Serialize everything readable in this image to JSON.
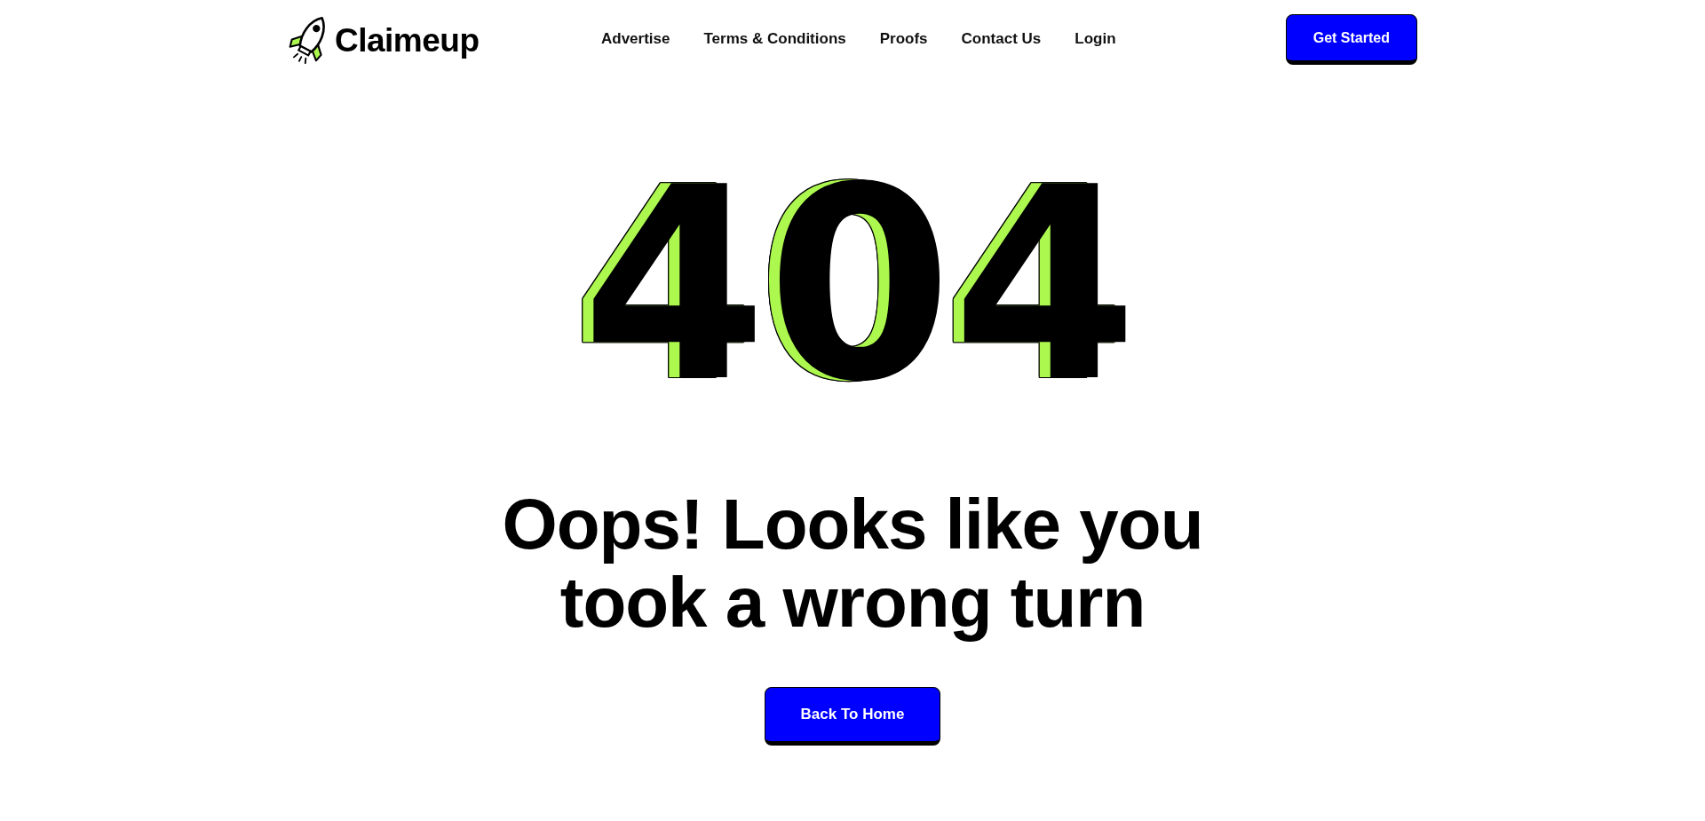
{
  "header": {
    "logo": "Claimeup",
    "nav": [
      "Advertise",
      "Terms & Conditions",
      "Proofs",
      "Contact Us",
      "Login"
    ],
    "cta": "Get Started"
  },
  "error": {
    "code": "404",
    "message": "Oops! Looks like you took a wrong turn",
    "button": "Back To Home"
  }
}
